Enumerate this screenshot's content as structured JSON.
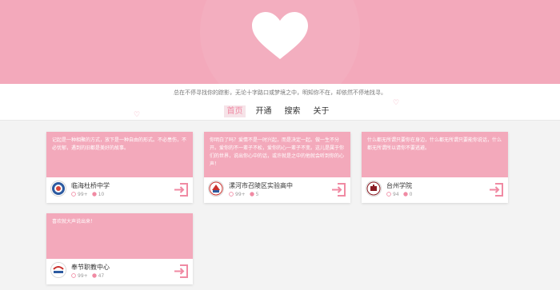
{
  "header": {
    "tagline": "总在不停寻找你的踪影，无论十字路口或梦境之中，明知你不在，却依然不停地找寻。"
  },
  "nav": {
    "items": [
      {
        "label": "首页",
        "active": true
      },
      {
        "label": "开通",
        "active": false
      },
      {
        "label": "搜索",
        "active": false
      },
      {
        "label": "关于",
        "active": false
      }
    ]
  },
  "cards": [
    {
      "message": "记起是一种相聚的方式，放下是一种自由的形式。不必患伤，不必忧郁，遇到的旧都是美好的故事。",
      "school": "临海杜桥中学",
      "likes": "99+",
      "comments": "10",
      "avatar_icon": "school-emblem-icon"
    },
    {
      "message": "你明白了吗？爱情不是一时兴起，而是决定一起。做一生不分开。爱你的不一辈子不松，爱你的心一辈子不变。这儿是属于你们的世界，说出你心中的话，或许就是之中的他就会听到你的心声！",
      "school": "漯河市召陵区实验高中",
      "likes": "99+",
      "comments": "5",
      "avatar_icon": "school-emblem-icon"
    },
    {
      "message": "什么都无所谓只要你在身边，什么都无所谓只要能你说话，什么都无所谓所以请你不要逃避。",
      "school": "台州学院",
      "likes": "94",
      "comments": "0",
      "avatar_icon": "school-emblem-icon"
    },
    {
      "message": "喜欢就大声说出来！",
      "school": "奉节职教中心",
      "likes": "99+",
      "comments": "47",
      "avatar_icon": "school-logo-icon"
    }
  ],
  "colors": {
    "brand_pink": "#f3a9bb",
    "accent_pink": "#f08aa3",
    "background": "#f3f3f3"
  }
}
